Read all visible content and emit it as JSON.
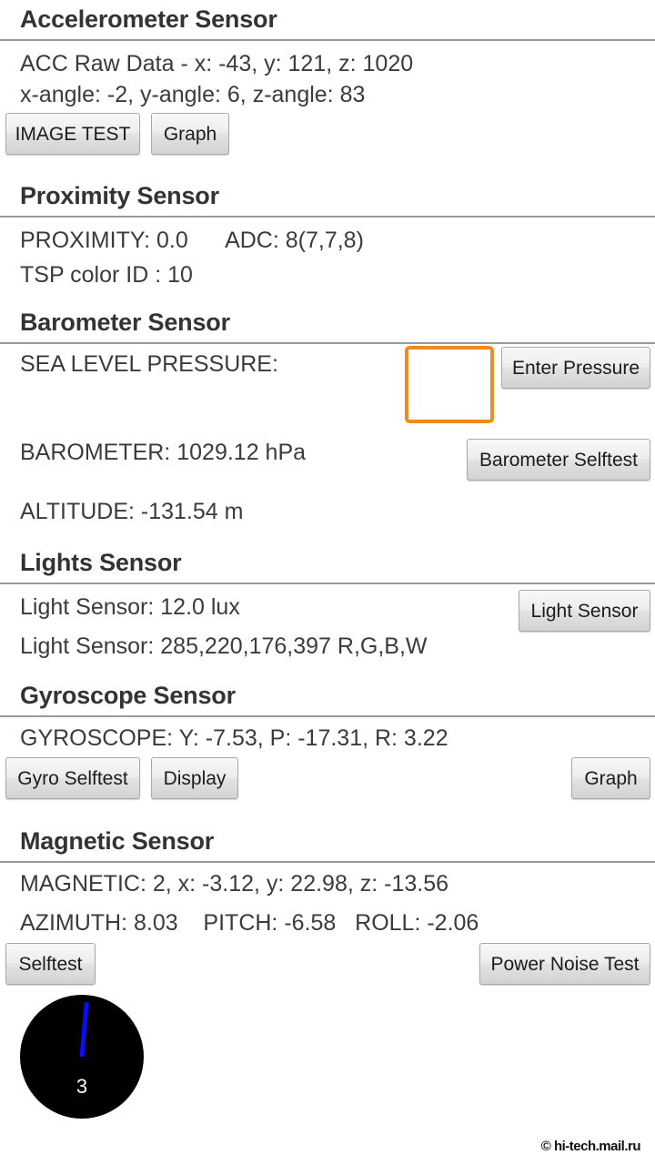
{
  "sections": [
    {
      "id": "accelerometer",
      "title": "Accelerometer Sensor",
      "lines": [
        "ACC Raw Data - x: -43, y: 121, z: 1020",
        "x-angle: -2, y-angle: 6, z-angle: 83"
      ],
      "buttons": [
        {
          "label": "IMAGE TEST"
        },
        {
          "label": "Graph"
        }
      ]
    },
    {
      "id": "proximity",
      "title": "Proximity Sensor",
      "lines": [
        "PROXIMITY: 0.0      ADC: 8(7,7,8)",
        "TSP color ID : 10"
      ],
      "buttons": []
    },
    {
      "id": "barometer",
      "title": "Barometer Sensor",
      "lines": [
        "SEA LEVEL PRESSURE:",
        "BAROMETER: 1029.12 hPa",
        "ALTITUDE: -131.54 m"
      ],
      "input": {
        "value": "",
        "placeholder": ""
      },
      "buttons": [
        {
          "label": "Enter Pressure"
        },
        {
          "label": "Barometer Selftest"
        }
      ]
    },
    {
      "id": "lights",
      "title": "Lights Sensor",
      "lines": [
        "Light Sensor: 12.0 lux",
        "Light Sensor: 285,220,176,397 R,G,B,W"
      ],
      "buttons": [
        {
          "label": "Light Sensor"
        }
      ]
    },
    {
      "id": "gyroscope",
      "title": "Gyroscope Sensor",
      "lines": [
        "GYROSCOPE: Y: -7.53, P: -17.31, R: 3.22"
      ],
      "buttons": [
        {
          "label": "Gyro Selftest"
        },
        {
          "label": "Display"
        },
        {
          "label": "Graph"
        }
      ]
    },
    {
      "id": "magnetic",
      "title": "Magnetic Sensor",
      "lines": [
        "MAGNETIC: 2, x: -3.12, y: 22.98, z: -13.56",
        "AZIMUTH: 8.03    PITCH: -6.58   ROLL: -2.06"
      ],
      "buttons": [
        {
          "label": "Selftest"
        },
        {
          "label": "Power Noise Test"
        }
      ],
      "compass": {
        "value": "3"
      }
    }
  ],
  "watermark": "© hi-tech.mail.ru",
  "colors": {
    "accent_focus": "#f28a20",
    "header_text": "#333333",
    "body_text": "#3b3b3b",
    "divider": "#9a9a9a",
    "compass_background": "#000000",
    "compass_needle": "#0c0cf0"
  }
}
